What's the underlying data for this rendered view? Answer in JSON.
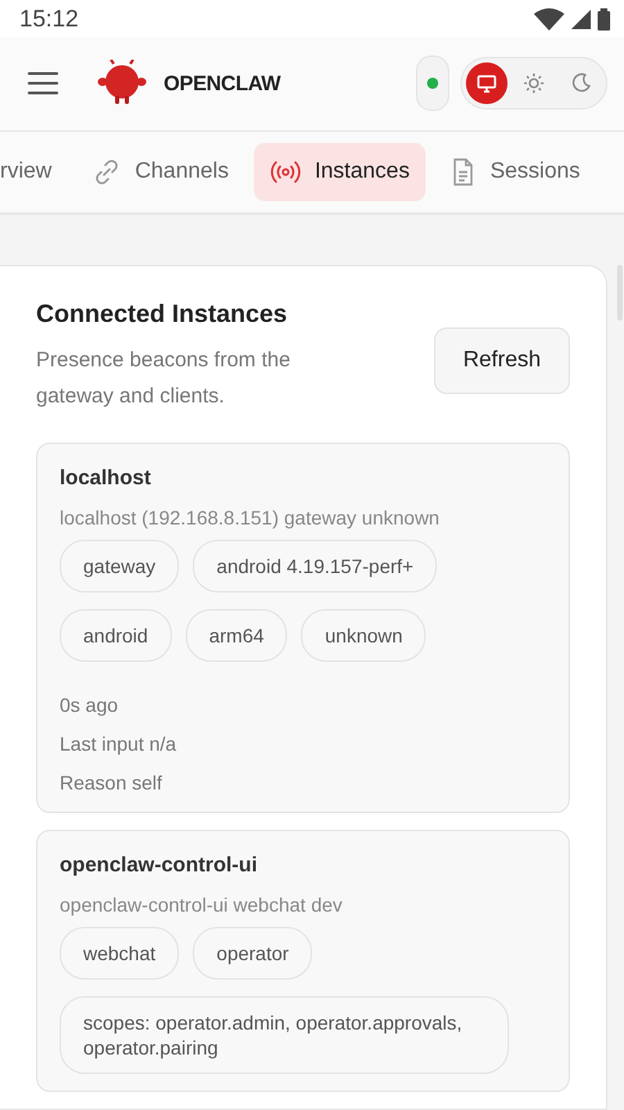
{
  "status_bar": {
    "time": "15:12"
  },
  "header": {
    "brand": "OPENCLAW",
    "connected": true,
    "themes": [
      {
        "kind": "system",
        "selected": true
      },
      {
        "kind": "light",
        "selected": false
      },
      {
        "kind": "dark",
        "selected": false
      }
    ]
  },
  "tabs": [
    {
      "label": "rview",
      "selected": false
    },
    {
      "label": "Channels",
      "selected": false
    },
    {
      "label": "Instances",
      "selected": true
    },
    {
      "label": "Sessions",
      "selected": false
    }
  ],
  "panel": {
    "title": "Connected Instances",
    "subtitle": "Presence beacons from the gateway and clients.",
    "refresh_button": "Refresh",
    "instances": [
      {
        "name": "localhost",
        "meta": "localhost (192.168.8.151) gateway unknown",
        "chips": [
          "gateway",
          "android 4.19.157-perf+",
          "android",
          "arm64",
          "unknown"
        ],
        "details": [
          "0s ago",
          "Last input n/a",
          "Reason self"
        ]
      },
      {
        "name": "openclaw-control-ui",
        "meta": "openclaw-control-ui webchat dev",
        "chips": [
          "webchat",
          "operator",
          "scopes: operator.admin, operator.approvals, operator.pairing"
        ]
      }
    ]
  }
}
